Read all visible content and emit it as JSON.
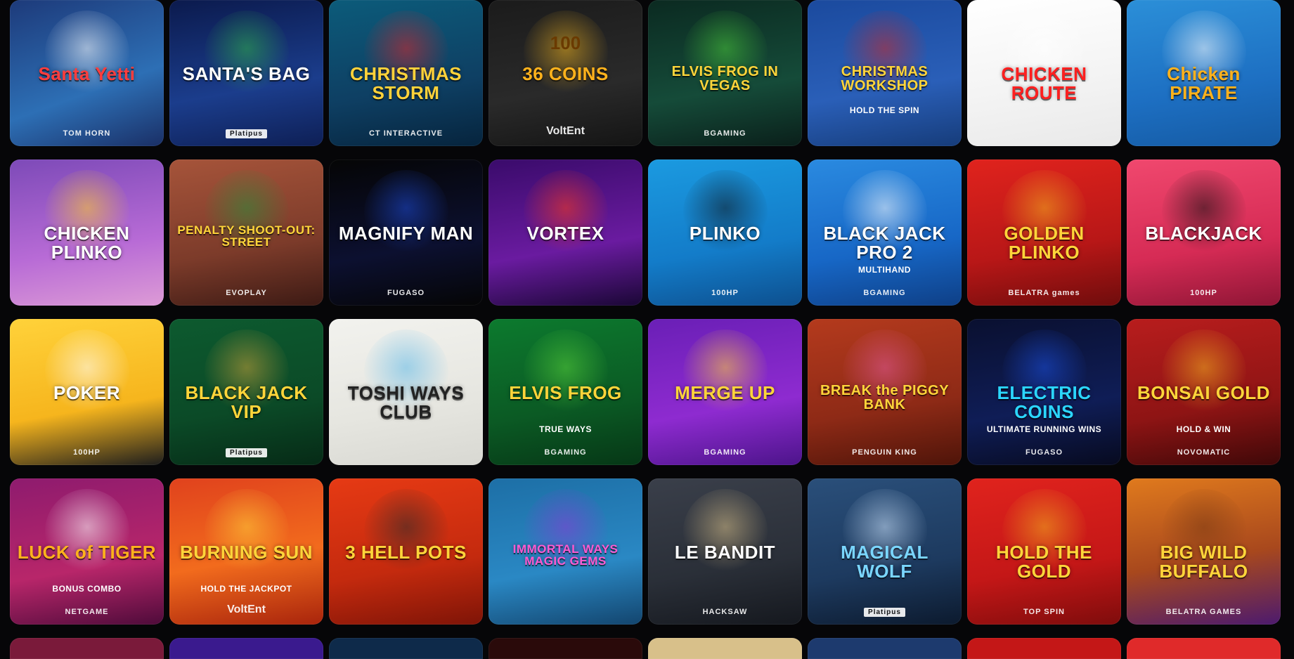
{
  "games": [
    {
      "title": "Santa Yetti",
      "provider": "TOM HORN",
      "bg": "linear-gradient(160deg,#1d3a7a,#2d6fb5 60%,#1a2f66)",
      "title_color": "#ff3d3d",
      "deco": "#ffffff"
    },
    {
      "title": "SANTA'S BAG",
      "provider": "Platipus",
      "provider_style": "boxed",
      "bg": "linear-gradient(170deg,#0b1a4d,#1b3d8c 60%,#0e1f55)",
      "title_color": "#ffffff",
      "deco": "#2fb34a"
    },
    {
      "title": "CHRISTMAS STORM",
      "provider": "CT INTERACTIVE",
      "bg": "linear-gradient(170deg,#0c5b7a,#0e3f63 60%,#06243d)",
      "title_color": "#ffd23a",
      "deco": "#d8262b"
    },
    {
      "title": "36 COINS",
      "badge": "100",
      "provider": "VoltEnt",
      "provider_style": "voltent",
      "bg": "linear-gradient(170deg,#1b1b1b,#2a2a2a 60%,#141414)",
      "title_color": "#ffb21c",
      "deco": "#f1b41f"
    },
    {
      "title": "ELVIS FROG IN VEGAS",
      "provider": "BGAMING",
      "bg": "linear-gradient(170deg,#0b2a21,#154b39 60%,#0a1f1a)",
      "title_color": "#ffd53a",
      "deco": "#49c93a"
    },
    {
      "title": "CHRISTMAS WORKSHOP",
      "subtitle": "HOLD THE SPIN",
      "bg": "linear-gradient(170deg,#1b4a9e,#2a5fb8 60%,#163c7a)",
      "title_color": "#ffd53a",
      "deco": "#c82a2a"
    },
    {
      "title": "CHICKEN ROUTE",
      "bg": "linear-gradient(170deg,#ffffff,#f4f4f4 55%,#e9e9e9)",
      "title_color": "#ff1f1f",
      "deco": "#ffffff"
    },
    {
      "title": "Chicken PIRATE",
      "bg": "linear-gradient(170deg,#2b8fd8,#1d6fc2 60%,#155aa3)",
      "title_color": "#ffb21c",
      "deco": "#ffffff"
    },
    {
      "title": "CHICKEN PLINKO",
      "bg": "linear-gradient(170deg,#7d4ab8,#b86bd6 60%,#dd9bd6)",
      "title_color": "#ffffff",
      "deco": "#ffcf2a"
    },
    {
      "title": "PENALTY SHOOT-OUT: STREET",
      "provider": "EVOPLAY",
      "bg": "linear-gradient(170deg,#a6543a,#7c3b2a 60%,#3c1a14)",
      "title_color": "#ffd53a",
      "deco": "#2b8c3a"
    },
    {
      "title": "MAGNIFY MAN",
      "provider": "FUGASO",
      "bg": "linear-gradient(170deg,#050505,#0c1030 60%,#050505)",
      "title_color": "#ffffff",
      "deco": "#1d4bd8"
    },
    {
      "title": "VORTEX",
      "bg": "linear-gradient(170deg,#3a0b6b,#6a1ba0 60%,#1a0735)",
      "title_color": "#ffffff",
      "deco": "#ff3a1a"
    },
    {
      "title": "PLINKO",
      "provider": "100HP",
      "bg": "linear-gradient(170deg,#1b9ae0,#137cc9 60%,#0d4f8e)",
      "title_color": "#ffffff",
      "deco": "#101820"
    },
    {
      "title": "BLACK JACK PRO 2",
      "subtitle": "MULTIHAND",
      "provider": "BGAMING",
      "bg": "linear-gradient(170deg,#2a8ae0,#1767c6 60%,#0e3f86)",
      "title_color": "#ffffff",
      "deco": "#ffffff"
    },
    {
      "title": "GOLDEN PLINKO",
      "provider": "BELATRA games",
      "bg": "linear-gradient(170deg,#e0231d,#b81717 60%,#6e0c0c)",
      "title_color": "#ffd53a",
      "deco": "#f3b21f"
    },
    {
      "title": "BLACKJACK",
      "provider": "100HP",
      "bg": "linear-gradient(170deg,#f0486e,#d62b55 60%,#8e1535)",
      "title_color": "#ffffff",
      "deco": "#111111"
    },
    {
      "title": "POKER",
      "provider": "100HP",
      "bg": "linear-gradient(170deg,#ffd23a,#f6b51d 60%,#1d1d1d)",
      "title_color": "#ffffff",
      "deco": "#ffffff"
    },
    {
      "title": "BLACK JACK VIP",
      "provider": "Platipus",
      "provider_style": "boxed",
      "bg": "linear-gradient(170deg,#0d5a2f,#0b4a27 60%,#062a16)",
      "title_color": "#ffd53a",
      "deco": "#c9a23a"
    },
    {
      "title": "TOSHI WAYS CLUB",
      "bg": "linear-gradient(170deg,#f2f2ee,#e6e6e0 60%,#d8d8d2)",
      "title_color": "#222222",
      "deco": "#5db9e8"
    },
    {
      "title": "ELVIS FROG",
      "subtitle": "TRUE WAYS",
      "provider": "BGAMING",
      "bg": "linear-gradient(170deg,#0c7a2e,#0b5a24 60%,#063716)",
      "title_color": "#ffd53a",
      "deco": "#58d23a"
    },
    {
      "title": "MERGE UP",
      "provider": "BGAMING",
      "bg": "linear-gradient(170deg,#6a1fb6,#8e2bd0 60%,#4c148a)",
      "title_color": "#ffd53a",
      "deco": "#ffd23a"
    },
    {
      "title": "BREAK the PIGGY BANK",
      "provider": "PENGUIN KING",
      "bg": "linear-gradient(170deg,#b43a1d,#8e2a16 60%,#4e1409)",
      "title_color": "#ffd53a",
      "deco": "#e25a9a"
    },
    {
      "title": "ELECTRIC COINS",
      "subtitle": "ULTIMATE RUNNING WINS",
      "provider": "FUGASO",
      "bg": "linear-gradient(170deg,#0a1030,#0f1d56 60%,#070a1f)",
      "title_color": "#2bd6ff",
      "deco": "#1a4fe0"
    },
    {
      "title": "BONSAI GOLD",
      "subtitle": "HOLD & WIN",
      "provider": "NOVOMATIC",
      "bg": "linear-gradient(170deg,#b81d1d,#8e1414 60%,#3e0808)",
      "title_color": "#ffd53a",
      "deco": "#f3b21f"
    },
    {
      "title": "LUCK of TIGER",
      "subtitle": "BONUS COMBO",
      "provider": "NETGAME",
      "bg": "linear-gradient(170deg,#8e1b6e,#b8266a 60%,#4e0b3a)",
      "title_color": "#ffb21c",
      "deco": "#ffffff"
    },
    {
      "title": "BURNING SUN",
      "subtitle": "HOLD THE JACKPOT",
      "provider": "VoltEnt",
      "provider_style": "voltent",
      "bg": "linear-gradient(170deg,#e0421d,#f26b1d 55%,#a8240c)",
      "title_color": "#ffd53a",
      "deco": "#ffd23a"
    },
    {
      "title": "3 HELL POTS",
      "bg": "linear-gradient(170deg,#e63a14,#c42a0e 60%,#7e1407)",
      "title_color": "#ffd53a",
      "deco": "#2a2a2a"
    },
    {
      "title": "IMMORTAL WAYS MAGIC GEMS",
      "bg": "linear-gradient(170deg,#1d6fa6,#2a88c4 60%,#13456e)",
      "title_color": "#ff5ad2",
      "deco": "#8a3ad6"
    },
    {
      "title": "LE BANDIT",
      "provider": "HACKSAW",
      "bg": "linear-gradient(170deg,#3a3f4a,#2a2f38 60%,#15181e)",
      "title_color": "#ffffff",
      "deco": "#d8c08a"
    },
    {
      "title": "MAGICAL WOLF",
      "provider": "Platipus",
      "provider_style": "boxed",
      "bg": "linear-gradient(170deg,#2a4f7a,#1d3a5f 60%,#0c1a2e)",
      "title_color": "#7ad6ff",
      "deco": "#cfe6ff"
    },
    {
      "title": "HOLD THE GOLD",
      "provider": "TOP SPIN",
      "bg": "linear-gradient(170deg,#e0231d,#c41717 60%,#7e0c0c)",
      "title_color": "#ffd53a",
      "deco": "#f3b21f"
    },
    {
      "title": "BIG WILD BUFFALO",
      "provider": "BELATRA GAMES",
      "bg": "linear-gradient(170deg,#e07a1d,#a8481d 55%,#4c1a6e)",
      "title_color": "#ffd53a",
      "deco": "#7a3a14"
    }
  ],
  "partial_row": [
    "#7a1a3a",
    "#3a1a8e",
    "#0e2a4a",
    "#2a0a0a",
    "#d8c08a",
    "#1d3a6e",
    "#c41717",
    "#e02a2a"
  ]
}
